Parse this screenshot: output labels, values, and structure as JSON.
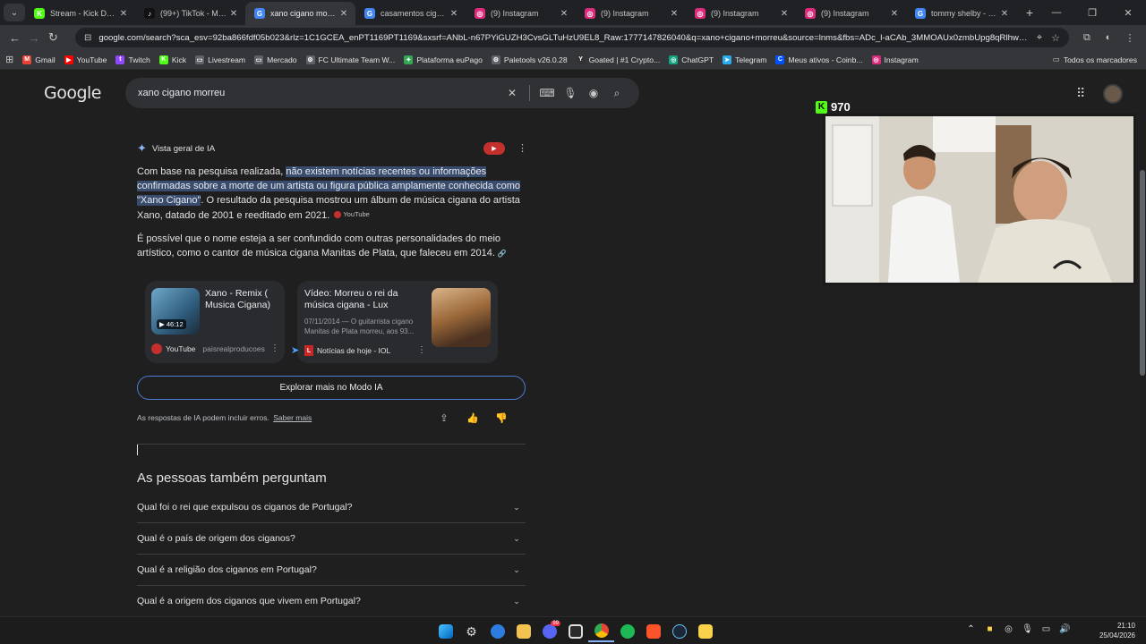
{
  "browser": {
    "tabs": [
      {
        "label": "Stream - Kick Dashb...",
        "favicon": "K",
        "color": "#53fc18",
        "active": false
      },
      {
        "label": "(99+) TikTok - Make Y...",
        "favicon": "♪",
        "color": "#111111",
        "active": false
      },
      {
        "label": "xano cigano morreu",
        "favicon": "G",
        "color": "#4285f4",
        "active": true
      },
      {
        "label": "casamentos ciganos...",
        "favicon": "G",
        "color": "#4285f4",
        "active": false
      },
      {
        "label": "(9) Instagram",
        "favicon": "◎",
        "color": "#dd2a7b",
        "active": false
      },
      {
        "label": "(9) Instagram",
        "favicon": "◎",
        "color": "#dd2a7b",
        "active": false
      },
      {
        "label": "(9) Instagram",
        "favicon": "◎",
        "color": "#dd2a7b",
        "active": false
      },
      {
        "label": "(9) Instagram",
        "favicon": "◎",
        "color": "#dd2a7b",
        "active": false
      },
      {
        "label": "tommy shelby - Pesq...",
        "favicon": "G",
        "color": "#4285f4",
        "active": false
      }
    ],
    "url": "google.com/search?sca_esv=92ba866fdf05b023&rlz=1C1GCEA_enPT1169PT1169&sxsrf=ANbL-n67PYiGUZH3CvsGLTuHzU9EL8_Raw:1777147826040&q=xano+cigano+morreu&source=lnms&fbs=ADc_l-aCAb_3MMOAUx0zmbUpg8qRlhw7OXILrtq8_9...",
    "bookmarks": [
      {
        "label": "Gmail",
        "icon": "M",
        "color": "#ea4335"
      },
      {
        "label": "YouTube",
        "icon": "▶",
        "color": "#ff0000"
      },
      {
        "label": "Twitch",
        "icon": "t",
        "color": "#9146ff"
      },
      {
        "label": "Kick",
        "icon": "K",
        "color": "#53fc18"
      },
      {
        "label": "Livestream",
        "icon": "▭",
        "color": "#5f6368"
      },
      {
        "label": "Mercado",
        "icon": "▭",
        "color": "#5f6368"
      },
      {
        "label": "FC Ultimate Team W...",
        "icon": "⚙",
        "color": "#5f6368"
      },
      {
        "label": "Plataforma euPago",
        "icon": "✦",
        "color": "#34a853"
      },
      {
        "label": "Paletools v26.0.28",
        "icon": "⚙",
        "color": "#5f6368"
      },
      {
        "label": "Goated | #1 Crypto...",
        "icon": "Y",
        "color": "#333333"
      },
      {
        "label": "ChatGPT",
        "icon": "◎",
        "color": "#10a37f"
      },
      {
        "label": "Telegram",
        "icon": "➤",
        "color": "#2aabee"
      },
      {
        "label": "Meus ativos - Coinb...",
        "icon": "C",
        "color": "#0052ff"
      },
      {
        "label": "Instagram",
        "icon": "◎",
        "color": "#dd2a7b"
      }
    ],
    "all_bookmarks_label": "Todos os marcadores"
  },
  "search": {
    "logo": "Google",
    "query": "xano cigano morreu"
  },
  "ai_overview": {
    "header": "Vista geral de IA",
    "para1_before": "Com base na pesquisa realizada, ",
    "para1_highlight": "não existem notícias recentes ou informações confirmadas sobre a morte de um artista ou figura pública amplamente conhecida como \"Xano Cigano\"",
    "para1_after": ". O resultado da pesquisa mostrou um álbum de música cigana do artista Xano, datado de 2001 e reeditado em 2021.",
    "para1_chip": "YouTube",
    "para2": "É possível que o nome esteja a ser confundido com outras personalidades do meio artístico, como o cantor de música cigana Manitas de Plata, que faleceu em 2014.",
    "cards": [
      {
        "title": "Xano - Remix ( Musica Cigana)",
        "duration": "46:12",
        "source": "YouTube",
        "channel": "paisrealproducoes"
      },
      {
        "title": "Vídeo: Morreu o rei da música cigana - Lux",
        "snippet": "07/11/2014 — O guitarrista cigano Manitas de Plata morreu, aos 93...",
        "source": "Notícias de hoje - IOL"
      }
    ],
    "explore_label": "Explorar mais no Modo IA",
    "disclaimer": "As respostas de IA podem incluir erros.",
    "learn_more": "Saber mais"
  },
  "paa": {
    "title": "As pessoas também perguntam",
    "questions": [
      "Qual foi o rei que expulsou os ciganos de Portugal?",
      "Qual é o país de origem dos ciganos?",
      "Qual é a religião dos ciganos em Portugal?",
      "Qual é a origem dos ciganos que vivem em Portugal?"
    ]
  },
  "stream": {
    "viewer_count": "970",
    "logo": "K"
  },
  "taskbar": {
    "time": "21:10",
    "date": "25/04/2026",
    "discord_badge": "99"
  }
}
